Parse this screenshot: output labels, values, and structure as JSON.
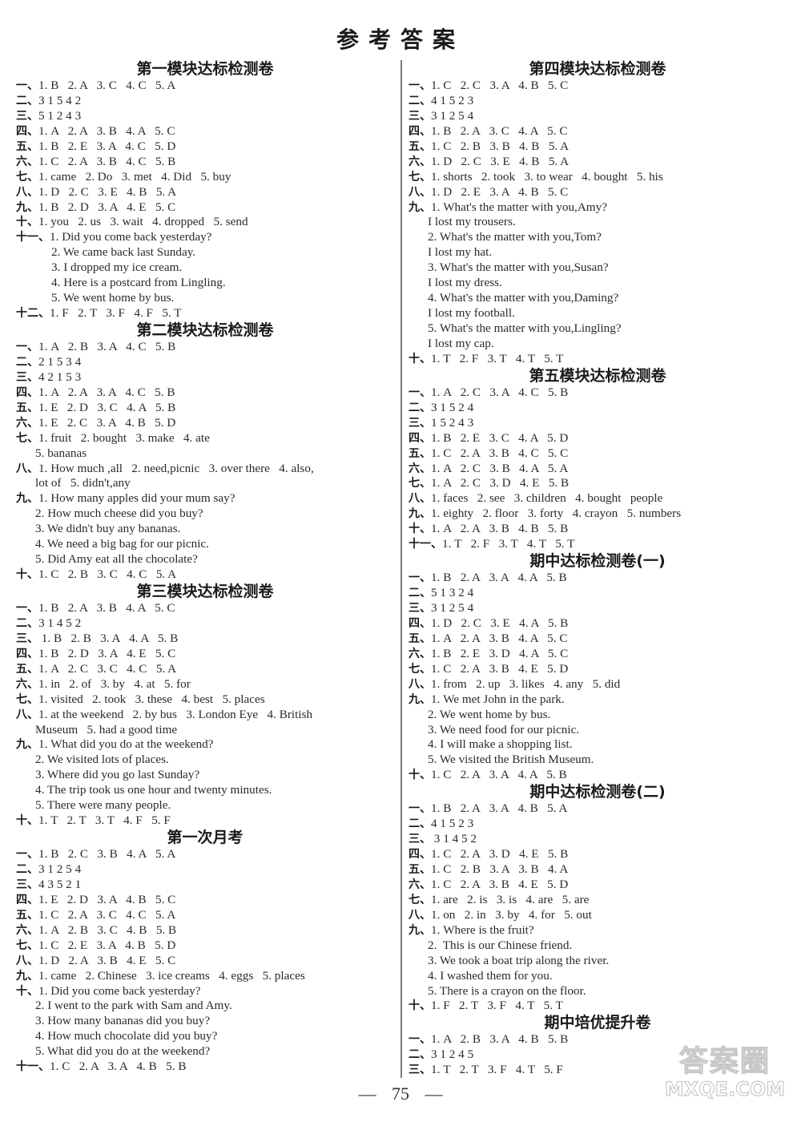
{
  "page_title": "参考答案",
  "page_number": "75",
  "watermark": {
    "cn": "答案圈",
    "en": "MXQE.COM"
  },
  "left_column": [
    {
      "title": "第一模块达标检测卷",
      "lines": [
        {
          "n": "一、",
          "t": "1. B   2. A   3. C   4. C   5. A"
        },
        {
          "n": "二、",
          "t": "3 1 5 4 2"
        },
        {
          "n": "三、",
          "t": "5 1 2 4 3"
        },
        {
          "n": "四、",
          "t": "1. A   2. A   3. B   4. A   5. C"
        },
        {
          "n": "五、",
          "t": "1. B   2. E   3. A   4. C   5. D"
        },
        {
          "n": "六、",
          "t": "1. C   2. A   3. B   4. C   5. B"
        },
        {
          "n": "七、",
          "t": "1. came   2. Do   3. met   4. Did   5. buy"
        },
        {
          "n": "八、",
          "t": "1. D   2. C   3. E   4. B   5. A"
        },
        {
          "n": "九、",
          "t": "1. B   2. D   3. A   4. E   5. C"
        },
        {
          "n": "十、",
          "t": "1. you   2. us   3. wait   4. dropped   5. send"
        },
        {
          "n": "十一、",
          "t": "1. Did you come back yesterday?"
        },
        {
          "n": "",
          "t": "2. We came back last Sunday.",
          "cont": true
        },
        {
          "n": "",
          "t": "3. I dropped my ice cream.",
          "cont": true
        },
        {
          "n": "",
          "t": "4. Here is a postcard from Lingling.",
          "cont": true
        },
        {
          "n": "",
          "t": "5. We went home by bus.",
          "cont": true
        },
        {
          "n": "十二、",
          "t": "1. F   2. T   3. F   4. F   5. T"
        }
      ]
    },
    {
      "title": "第二模块达标检测卷",
      "lines": [
        {
          "n": "一、",
          "t": "1. A   2. B   3. A   4. C   5. B"
        },
        {
          "n": "二、",
          "t": "2 1 5 3 4"
        },
        {
          "n": "三、",
          "t": "4 2 1 5 3"
        },
        {
          "n": "四、",
          "t": "1. A   2. A   3. A   4. C   5. B"
        },
        {
          "n": "五、",
          "t": "1. E   2. D   3. C   4. A   5. B"
        },
        {
          "n": "六、",
          "t": "1. E   2. C   3. A   4. B   5. D"
        },
        {
          "n": "七、",
          "t": "1. fruit   2. bought   3. make   4. ate"
        },
        {
          "n": "",
          "t": "5. bananas",
          "cont_s": true
        },
        {
          "n": "八、",
          "t": "1. How much ,all   2. need,picnic   3. over there   4. also,"
        },
        {
          "n": "",
          "t": "lot of   5. didn't,any",
          "cont_s": true
        },
        {
          "n": "九、",
          "t": "1. How many apples did your mum say?"
        },
        {
          "n": "",
          "t": "2. How much cheese did you buy?",
          "cont_s": true
        },
        {
          "n": "",
          "t": "3. We didn't buy any bananas.",
          "cont_s": true
        },
        {
          "n": "",
          "t": "4. We need a big bag for our picnic.",
          "cont_s": true
        },
        {
          "n": "",
          "t": "5. Did Amy eat all the chocolate?",
          "cont_s": true
        },
        {
          "n": "十、",
          "t": "1. C   2. B   3. C   4. C   5. A"
        }
      ]
    },
    {
      "title": "第三模块达标检测卷",
      "lines": [
        {
          "n": "一、",
          "t": "1. B   2. A   3. B   4. A   5. C"
        },
        {
          "n": "二、",
          "t": "3 1 4 5 2"
        },
        {
          "n": "三、",
          "t": " 1. B   2. B   3. A   4. A   5. B"
        },
        {
          "n": "四、",
          "t": "1. B   2. D   3. A   4. E   5. C"
        },
        {
          "n": "五、",
          "t": "1. A   2. C   3. C   4. C   5. A"
        },
        {
          "n": "六、",
          "t": "1. in   2. of   3. by   4. at   5. for"
        },
        {
          "n": "七、",
          "t": "1. visited   2. took   3. these   4. best   5. places"
        },
        {
          "n": "八、",
          "t": "1. at the weekend   2. by bus   3. London Eye   4. British"
        },
        {
          "n": "",
          "t": "Museum   5. had a good time",
          "cont_s": true
        },
        {
          "n": "九、",
          "t": "1. What did you do at the weekend?"
        },
        {
          "n": "",
          "t": "2. We visited lots of places.",
          "cont_s": true
        },
        {
          "n": "",
          "t": "3. Where did you go last Sunday?",
          "cont_s": true
        },
        {
          "n": "",
          "t": "4. The trip took us one hour and twenty minutes.",
          "cont_s": true
        },
        {
          "n": "",
          "t": "5. There were many people.",
          "cont_s": true
        },
        {
          "n": "十、",
          "t": "1. T   2. T   3. T   4. F   5. F"
        }
      ]
    },
    {
      "title": "第一次月考",
      "lines": [
        {
          "n": "一、",
          "t": "1. B   2. C   3. B   4. A   5. A"
        },
        {
          "n": "二、",
          "t": "3 1 2 5 4"
        },
        {
          "n": "三、",
          "t": "4 3 5 2 1"
        },
        {
          "n": "四、",
          "t": "1. E   2. D   3. A   4. B   5. C"
        },
        {
          "n": "五、",
          "t": "1. C   2. A   3. C   4. C   5. A"
        },
        {
          "n": "六、",
          "t": "1. A   2. B   3. C   4. B   5. B"
        },
        {
          "n": "七、",
          "t": "1. C   2. E   3. A   4. B   5. D"
        },
        {
          "n": "八、",
          "t": "1. D   2. A   3. B   4. E   5. C"
        },
        {
          "n": "九、",
          "t": "1. came   2. Chinese   3. ice creams   4. eggs   5. places"
        },
        {
          "n": "十、",
          "t": "1. Did you come back yesterday?"
        },
        {
          "n": "",
          "t": "2. I went to the park with Sam and Amy.",
          "cont_s": true
        },
        {
          "n": "",
          "t": "3. How many bananas did you buy?",
          "cont_s": true
        },
        {
          "n": "",
          "t": "4. How much chocolate did you buy?",
          "cont_s": true
        },
        {
          "n": "",
          "t": "5. What did you do at the weekend?",
          "cont_s": true
        },
        {
          "n": "十一、",
          "t": "1. C   2. A   3. A   4. B   5. B"
        }
      ]
    }
  ],
  "right_column": [
    {
      "title": "第四模块达标检测卷",
      "lines": [
        {
          "n": "一、",
          "t": "1. C   2. C   3. A   4. B   5. C"
        },
        {
          "n": "二、",
          "t": "4 1 5 2 3"
        },
        {
          "n": "三、",
          "t": "3 1 2 5 4"
        },
        {
          "n": "四、",
          "t": "1. B   2. A   3. C   4. A   5. C"
        },
        {
          "n": "五、",
          "t": "1. C   2. B   3. B   4. B   5. A"
        },
        {
          "n": "六、",
          "t": "1. D   2. C   3. E   4. B   5. A"
        },
        {
          "n": "七、",
          "t": "1. shorts   2. took   3. to wear   4. bought   5. his"
        },
        {
          "n": "八、",
          "t": "1. D   2. E   3. A   4. B   5. C"
        },
        {
          "n": "九、",
          "t": "1. What's the matter with you,Amy?"
        },
        {
          "n": "",
          "t": "I lost my trousers.",
          "cont_s": true
        },
        {
          "n": "",
          "t": "2. What's the matter with you,Tom?",
          "cont_s": true
        },
        {
          "n": "",
          "t": "I lost my hat.",
          "cont_s": true
        },
        {
          "n": "",
          "t": "3. What's the matter with you,Susan?",
          "cont_s": true
        },
        {
          "n": "",
          "t": "I lost my dress.",
          "cont_s": true
        },
        {
          "n": "",
          "t": "4. What's the matter with you,Daming?",
          "cont_s": true
        },
        {
          "n": "",
          "t": "I lost my football.",
          "cont_s": true
        },
        {
          "n": "",
          "t": "5. What's the matter with you,Lingling?",
          "cont_s": true
        },
        {
          "n": "",
          "t": "I lost my cap.",
          "cont_s": true
        },
        {
          "n": "十、",
          "t": "1. T   2. F   3. T   4. T   5. T"
        }
      ]
    },
    {
      "title": "第五模块达标检测卷",
      "lines": [
        {
          "n": "一、",
          "t": "1. A   2. C   3. A   4. C   5. B"
        },
        {
          "n": "二、",
          "t": "3 1 5 2 4"
        },
        {
          "n": "三、",
          "t": "1 5 2 4 3"
        },
        {
          "n": "四、",
          "t": "1. B   2. E   3. C   4. A   5. D"
        },
        {
          "n": "五、",
          "t": "1. C   2. A   3. B   4. C   5. C"
        },
        {
          "n": "六、",
          "t": "1. A   2. C   3. B   4. A   5. A"
        },
        {
          "n": "七、",
          "t": "1. A   2. C   3. D   4. E   5. B"
        },
        {
          "n": "八、",
          "t": "1. faces   2. see   3. children   4. bought   people"
        },
        {
          "n": "九、",
          "t": "1. eighty   2. floor   3. forty   4. crayon   5. numbers"
        },
        {
          "n": "十、",
          "t": "1. A   2. A   3. B   4. B   5. B"
        },
        {
          "n": "十一、",
          "t": "1. T   2. F   3. T   4. T   5. T"
        }
      ]
    },
    {
      "title": "期中达标检测卷(一)",
      "lines": [
        {
          "n": "一、",
          "t": "1. B   2. A   3. A   4. A   5. B"
        },
        {
          "n": "二、",
          "t": "5 1 3 2 4"
        },
        {
          "n": "三、",
          "t": "3 1 2 5 4"
        },
        {
          "n": "四、",
          "t": "1. D   2. C   3. E   4. A   5. B"
        },
        {
          "n": "五、",
          "t": "1. A   2. A   3. B   4. A   5. C"
        },
        {
          "n": "六、",
          "t": "1. B   2. E   3. D   4. A   5. C"
        },
        {
          "n": "七、",
          "t": "1. C   2. A   3. B   4. E   5. D"
        },
        {
          "n": "八、",
          "t": "1. from   2. up   3. likes   4. any   5. did"
        },
        {
          "n": "九、",
          "t": "1. We met John in the park."
        },
        {
          "n": "",
          "t": "2. We went home by bus.",
          "cont_s": true
        },
        {
          "n": "",
          "t": "3. We need food for our picnic.",
          "cont_s": true
        },
        {
          "n": "",
          "t": "4. I will make a shopping list.",
          "cont_s": true
        },
        {
          "n": "",
          "t": "5. We visited the British Museum.",
          "cont_s": true
        },
        {
          "n": "十、",
          "t": "1. C   2. A   3. A   4. A   5. B"
        }
      ]
    },
    {
      "title": "期中达标检测卷(二)",
      "lines": [
        {
          "n": "一、",
          "t": "1. B   2. A   3. A   4. B   5. A"
        },
        {
          "n": "二、",
          "t": "4 1 5 2 3"
        },
        {
          "n": "三、",
          "t": " 3 1 4 5 2"
        },
        {
          "n": "四、",
          "t": "1. C   2. A   3. D   4. E   5. B"
        },
        {
          "n": "五、",
          "t": "1. C   2. B   3. A   3. B   4. A"
        },
        {
          "n": "六、",
          "t": "1. C   2. A   3. B   4. E   5. D"
        },
        {
          "n": "七、",
          "t": "1. are   2. is   3. is   4. are   5. are"
        },
        {
          "n": "八、",
          "t": "1. on   2. in   3. by   4. for   5. out"
        },
        {
          "n": "九、",
          "t": "1. Where is the fruit?"
        },
        {
          "n": "",
          "t": "2.  This is our Chinese friend.",
          "cont_s": true
        },
        {
          "n": "",
          "t": "3. We took a boat trip along the river.",
          "cont_s": true
        },
        {
          "n": "",
          "t": "4. I washed them for you.",
          "cont_s": true
        },
        {
          "n": "",
          "t": "5. There is a crayon on the floor.",
          "cont_s": true
        },
        {
          "n": "十、",
          "t": "1. F   2. T   3. F   4. T   5. T"
        }
      ]
    },
    {
      "title": "期中培优提升卷",
      "lines": [
        {
          "n": "一、",
          "t": "1. A   2. B   3. A   4. B   5. B"
        },
        {
          "n": "二、",
          "t": "3 1 2 4 5"
        },
        {
          "n": "三、",
          "t": "1. T   2. T   3. F   4. T   5. F"
        }
      ]
    }
  ]
}
